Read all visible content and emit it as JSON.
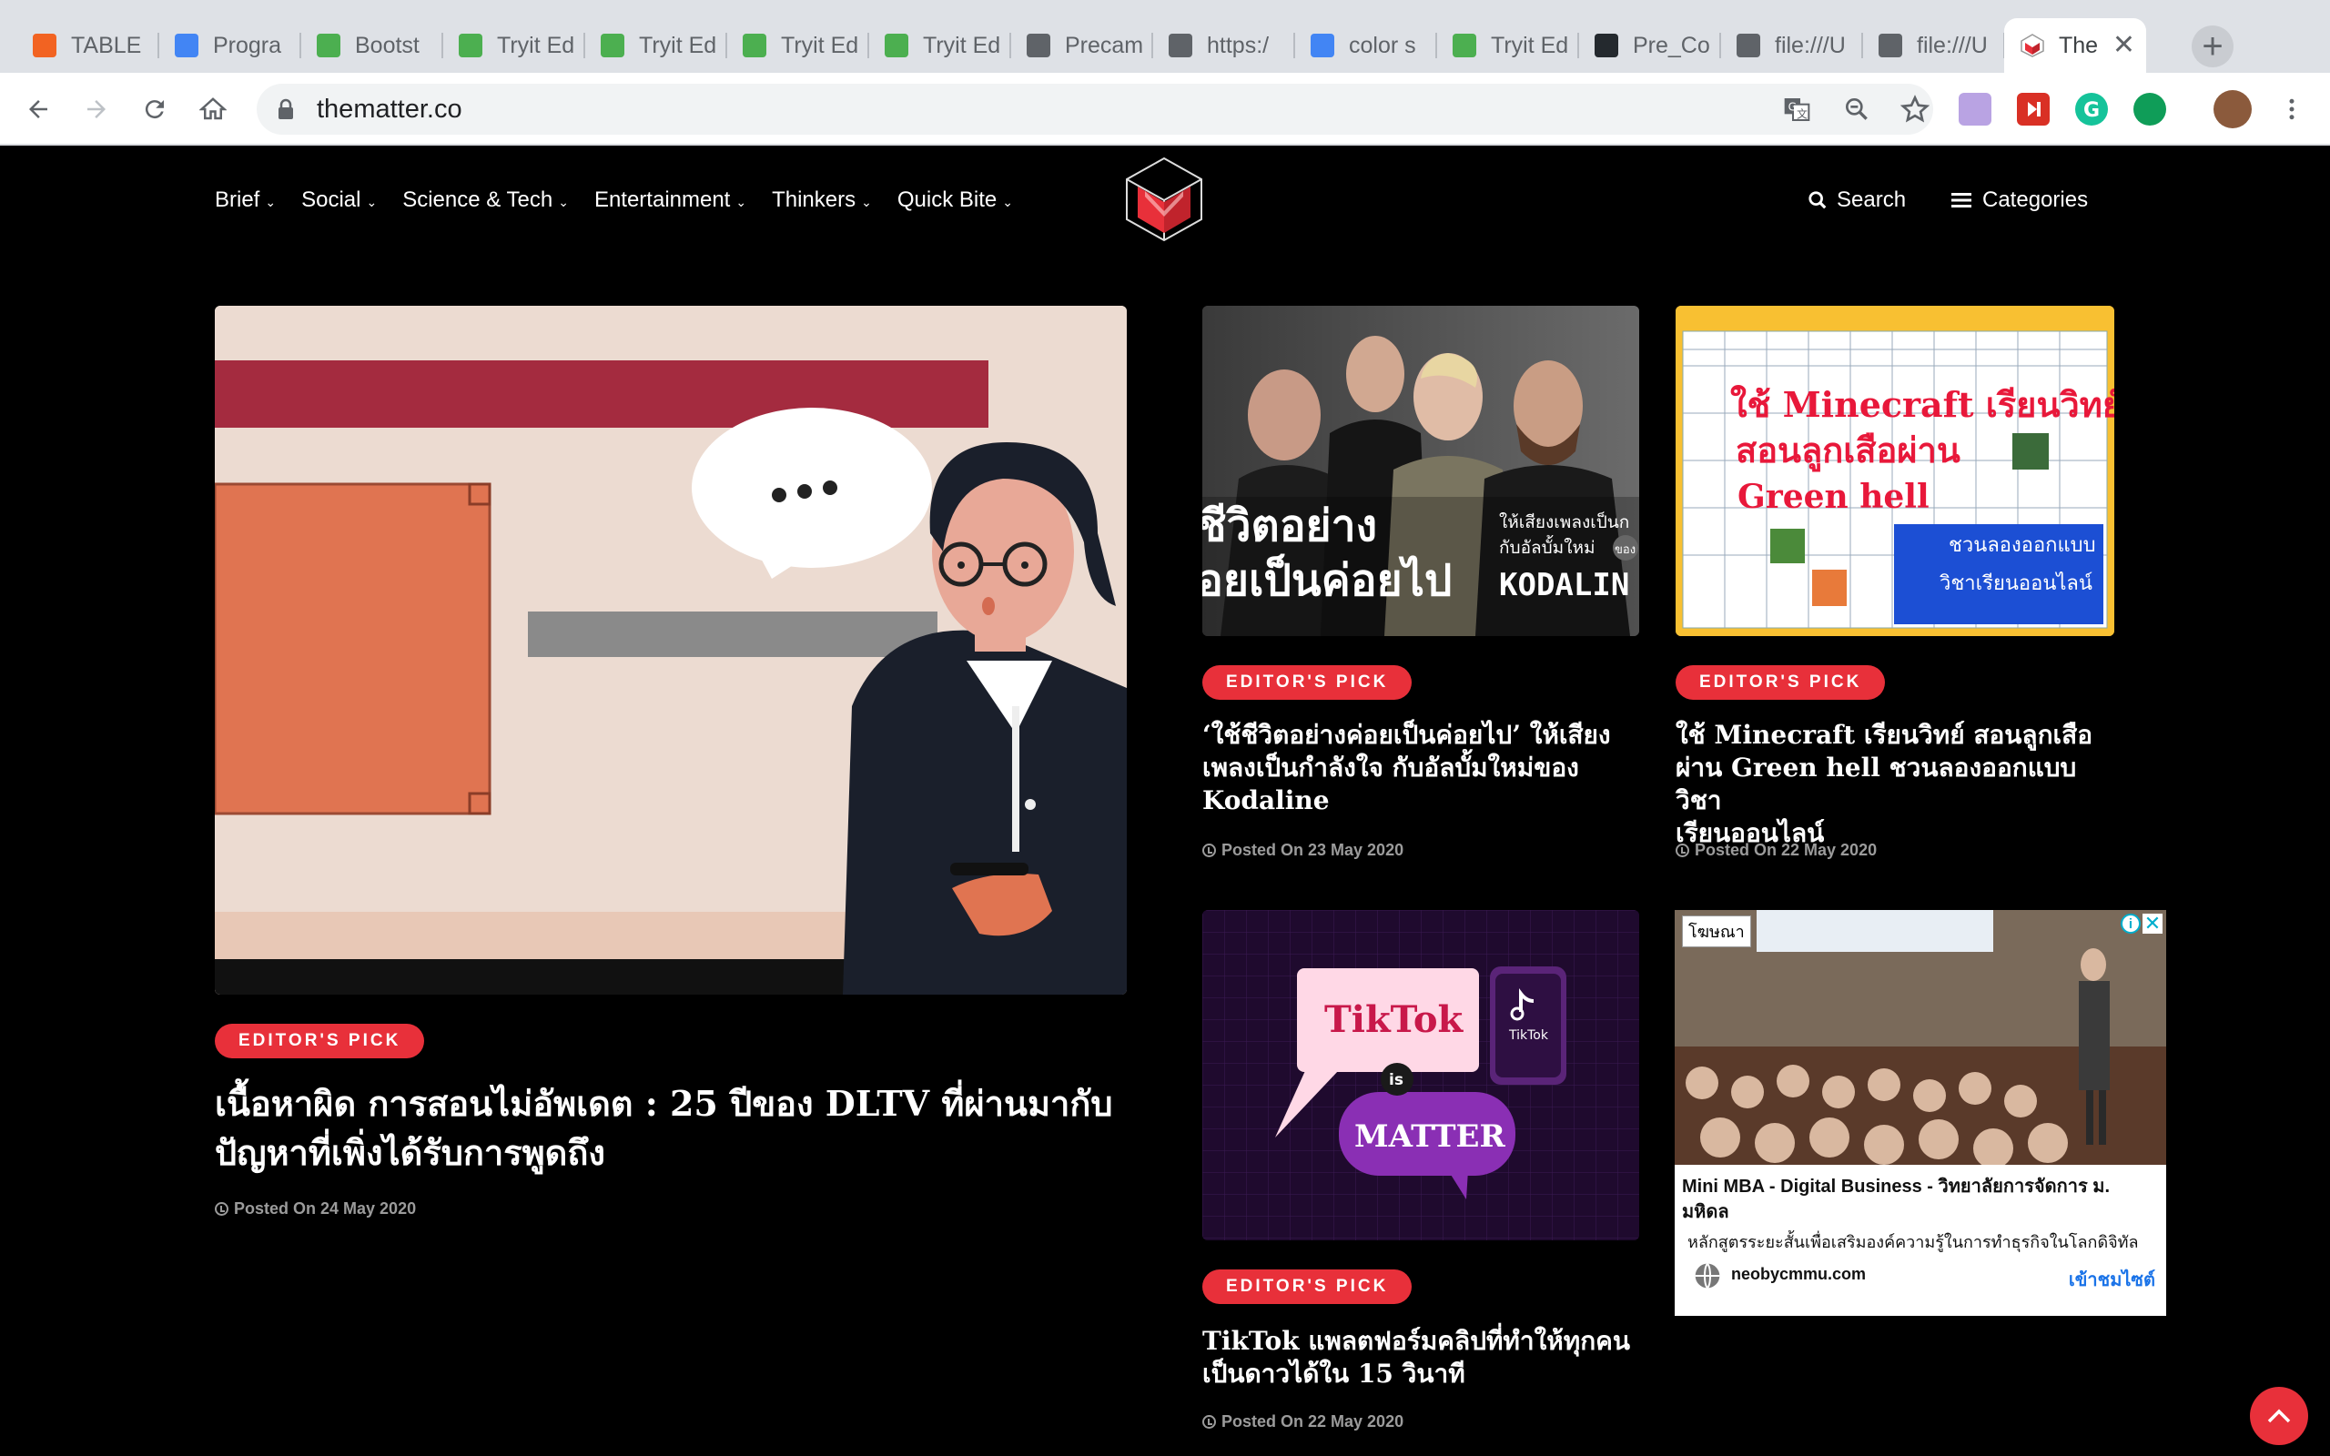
{
  "browser": {
    "tabs": [
      {
        "title": "TABLE",
        "favicon": "magento-icon",
        "color": "#f26322"
      },
      {
        "title": "Progra",
        "favicon": "docs-icon",
        "color": "#4285f4"
      },
      {
        "title": "Bootst",
        "favicon": "w3-icon",
        "color": "#4caf50"
      },
      {
        "title": "Tryit Ed",
        "favicon": "w3-icon",
        "color": "#4caf50"
      },
      {
        "title": "Tryit Ed",
        "favicon": "w3-icon",
        "color": "#4caf50"
      },
      {
        "title": "Tryit Ed",
        "favicon": "w3-icon",
        "color": "#4caf50"
      },
      {
        "title": "Tryit Ed",
        "favicon": "w3-icon",
        "color": "#4caf50"
      },
      {
        "title": "Precam",
        "favicon": "globe-icon",
        "color": "#5f6368"
      },
      {
        "title": "https:/",
        "favicon": "globe-icon",
        "color": "#5f6368"
      },
      {
        "title": "color s",
        "favicon": "google-icon",
        "color": "#4285f4"
      },
      {
        "title": "Tryit Ed",
        "favicon": "w3-icon",
        "color": "#4caf50"
      },
      {
        "title": "Pre_Co",
        "favicon": "github-icon",
        "color": "#24292e"
      },
      {
        "title": "file:///U",
        "favicon": "globe-icon",
        "color": "#5f6368"
      },
      {
        "title": "file:///U",
        "favicon": "globe-icon",
        "color": "#5f6368"
      }
    ],
    "active_tab": {
      "title": "The",
      "favicon": "thematter-icon"
    },
    "url": "thematter.co"
  },
  "site": {
    "nav": [
      "Brief",
      "Social",
      "Science & Tech",
      "Entertainment",
      "Thinkers",
      "Quick Bite"
    ],
    "search_label": "Search",
    "categories_label": "Categories",
    "accent": "#e8303a"
  },
  "featured": {
    "badge": "EDITOR'S PICK",
    "title_line1": "เนื้อหาผิด การสอนไม่อัพเดต : 25 ปีของ DLTV ที่ผ่านมากับ",
    "title_line2": "ปัญหาที่เพิ่งได้รับการพูดถึง",
    "posted": "Posted On 24 May 2020"
  },
  "articles": [
    {
      "badge": "EDITOR'S PICK",
      "lines": [
        "‘ใช้ชีวิตอย่างค่อยเป็นค่อยไป’ ให้เสียง",
        "เพลงเป็นกำลังใจ กับอัลบั้มใหม่ของ",
        "Kodaline"
      ],
      "posted": "Posted On 23 May 2020",
      "img_text_big1": "ชีวิตอย่าง",
      "img_text_big2": "อยเป็นค่อยไป",
      "img_text_small1": "ให้เสียงเพลงเป็นก",
      "img_text_small2": "กับอัลบั้มใหม่",
      "img_text_of": "ของ",
      "img_text_brand": "KODALIN"
    },
    {
      "badge": "EDITOR'S PICK",
      "lines": [
        "ใช้ Minecraft เรียนวิทย์ สอนลูกเสือ",
        "ผ่าน Green hell ชวนลองออกแบบวิชา",
        "เรียนออนไลน์"
      ],
      "posted": "Posted On 22 May 2020",
      "img_line1": "ใช้ Minecraft เรียนวิทย์",
      "img_line2": "สอนลูกเสือผ่าน",
      "img_line3": "Green hell",
      "img_box1": "ชวนลองออกแบบ",
      "img_box2": "วิชาเรียนออนไลน์"
    },
    {
      "badge": "EDITOR'S PICK",
      "lines": [
        "TikTok แพลตฟอร์มคลิปที่ทำให้ทุกคน",
        "เป็นดาวได้ใน 15 วินาที"
      ],
      "posted": "Posted On 22 May 2020",
      "img_tiktok": "TikTok",
      "img_is": "is",
      "img_matter": "MATTER",
      "img_small": "TikTok"
    }
  ],
  "ad": {
    "label": "โฆษณา",
    "title": "Mini MBA - Digital Business - วิทยาลัยการจัดการ ม. มหิดล",
    "description": "หลักสูตรระยะสั้นเพื่อเสริมองค์ความรู้ในการทำธุรกิจในโลกดิจิทัล",
    "domain": "neobycmmu.com",
    "cta": "เข้าชมไซต์"
  }
}
